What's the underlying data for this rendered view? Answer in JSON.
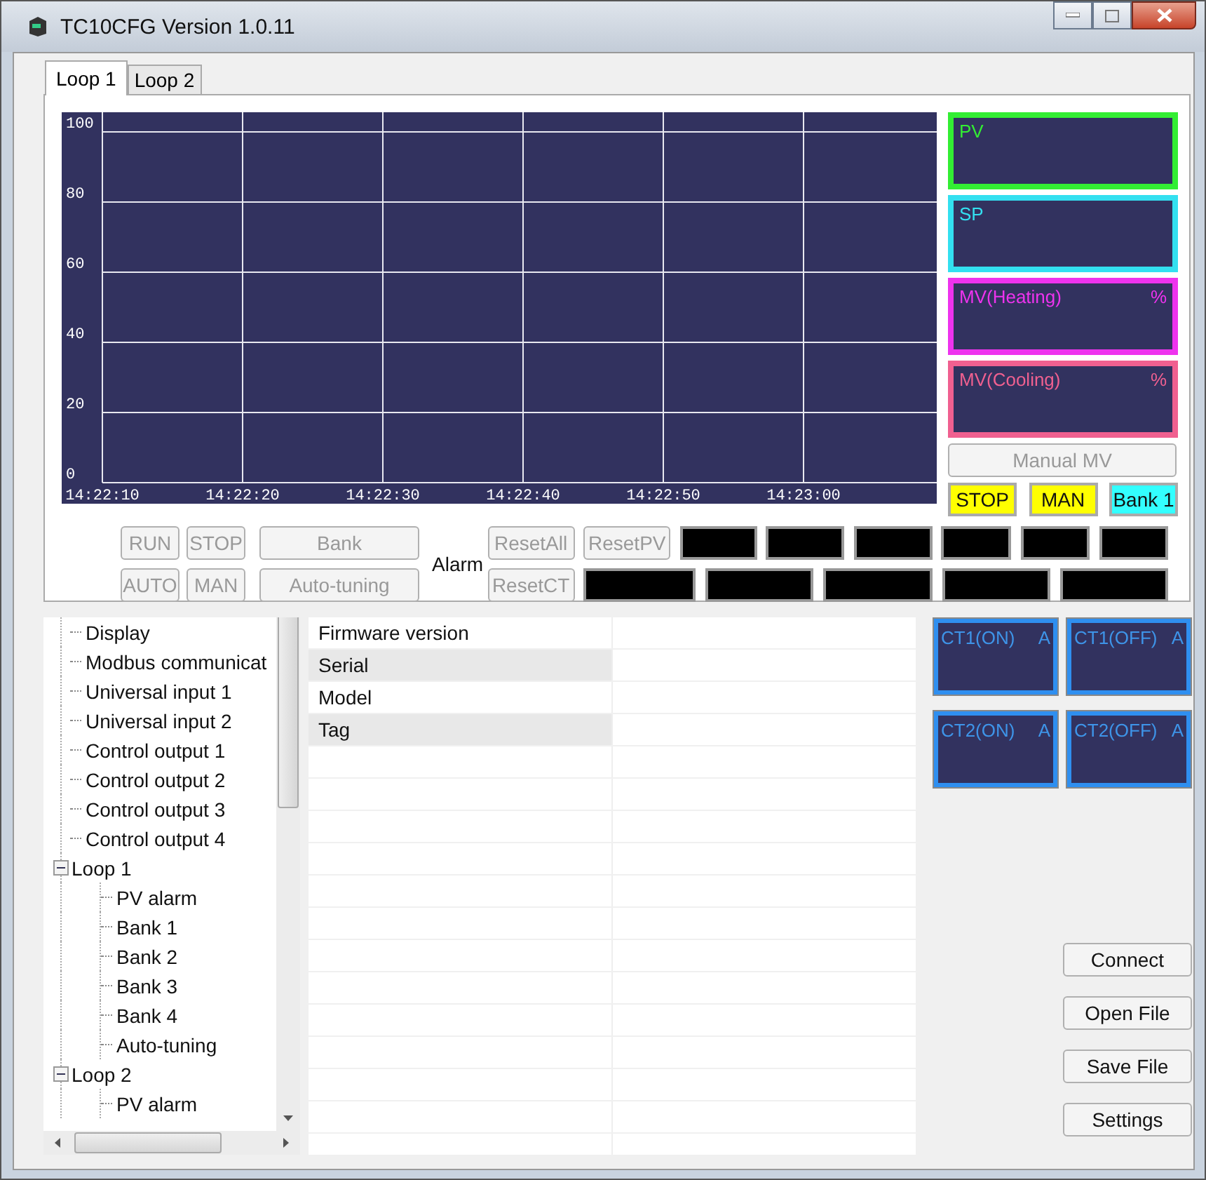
{
  "window": {
    "title": "TC10CFG Version 1.0.11"
  },
  "tabs": [
    {
      "label": "Loop 1",
      "selected": true
    },
    {
      "label": "Loop 2",
      "selected": false
    }
  ],
  "chart": {
    "chart_data": {
      "type": "line",
      "grid": true,
      "ylim": [
        0,
        100
      ],
      "yticks": [
        0,
        20,
        40,
        60,
        80,
        100
      ],
      "categories": [
        "14:22:10",
        "14:22:20",
        "14:22:30",
        "14:22:40",
        "14:22:50",
        "14:23:00"
      ]
    }
  },
  "displays": [
    {
      "label": "PV",
      "color": "#33ee33"
    },
    {
      "label": "SP",
      "color": "#33e0f0"
    },
    {
      "label": "MV(Heating)",
      "unit": "%",
      "color": "#ee33ee"
    },
    {
      "label": "MV(Cooling)",
      "unit": "%",
      "color": "#f06090"
    }
  ],
  "manual_mv_button": {
    "label": "Manual MV",
    "disabled": true
  },
  "status_indicators": [
    {
      "label": "STOP",
      "color": "#ffff00"
    },
    {
      "label": "MAN",
      "color": "#ffff00"
    },
    {
      "label": "Bank 1",
      "color": "#33ffff"
    }
  ],
  "run_buttons": [
    {
      "label": "RUN",
      "disabled": true
    },
    {
      "label": "STOP",
      "disabled": true
    },
    {
      "label": "AUTO",
      "disabled": true
    },
    {
      "label": "MAN",
      "disabled": true
    }
  ],
  "mode_buttons": [
    {
      "label": "Bank",
      "disabled": true
    },
    {
      "label": "Auto-tuning",
      "disabled": true
    }
  ],
  "alarm_label": "Alarm",
  "reset_buttons": [
    {
      "label": "ResetAll",
      "disabled": true
    },
    {
      "label": "ResetPV",
      "disabled": true
    },
    {
      "label": "ResetCT",
      "disabled": true
    }
  ],
  "tree": [
    {
      "label": "Display"
    },
    {
      "label": "Modbus communicat"
    },
    {
      "label": "Universal input 1"
    },
    {
      "label": "Universal input 2"
    },
    {
      "label": "Control output 1"
    },
    {
      "label": "Control output 2"
    },
    {
      "label": "Control output 3"
    },
    {
      "label": "Control output 4"
    },
    {
      "label": "Loop 1",
      "expanded": true,
      "children": [
        {
          "label": "PV alarm"
        },
        {
          "label": "Bank 1"
        },
        {
          "label": "Bank 2"
        },
        {
          "label": "Bank 3"
        },
        {
          "label": "Bank 4"
        },
        {
          "label": "Auto-tuning"
        }
      ]
    },
    {
      "label": "Loop 2",
      "expanded": true,
      "children": [
        {
          "label": "PV alarm"
        }
      ]
    }
  ],
  "info_table": [
    {
      "label": "Firmware version"
    },
    {
      "label": "Serial"
    },
    {
      "label": "Model"
    },
    {
      "label": "Tag"
    }
  ],
  "ct_displays": [
    {
      "label": "CT1(ON)",
      "unit": "A"
    },
    {
      "label": "CT1(OFF)",
      "unit": "A"
    },
    {
      "label": "CT2(ON)",
      "unit": "A"
    },
    {
      "label": "CT2(OFF)",
      "unit": "A"
    }
  ],
  "action_buttons": [
    {
      "label": "Connect"
    },
    {
      "label": "Open File"
    },
    {
      "label": "Save File"
    },
    {
      "label": "Settings"
    }
  ]
}
